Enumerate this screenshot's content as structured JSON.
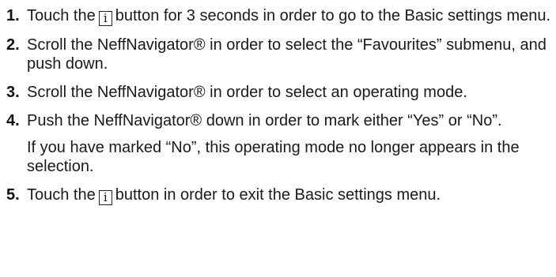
{
  "steps": [
    {
      "number": "1.",
      "text_before": "Touch the",
      "key": "i",
      "text_after": "button for 3 seconds in order to go to the Basic settings menu."
    },
    {
      "number": "2.",
      "text": "Scroll the NeffNavigator® in order to select the “Favourites” submenu, and push down."
    },
    {
      "number": "3.",
      "text": "Scroll the NeffNavigator® in order to select an operating mode."
    },
    {
      "number": "4.",
      "text": "Push the NeffNavigator® down in order to mark either “Yes” or “No”.",
      "note": "If you have marked “No”, this operating mode no longer appears in the selection."
    },
    {
      "number": "5.",
      "text_before": "Touch the",
      "key": "i",
      "text_after": "button in order to exit the Basic settings menu."
    }
  ]
}
